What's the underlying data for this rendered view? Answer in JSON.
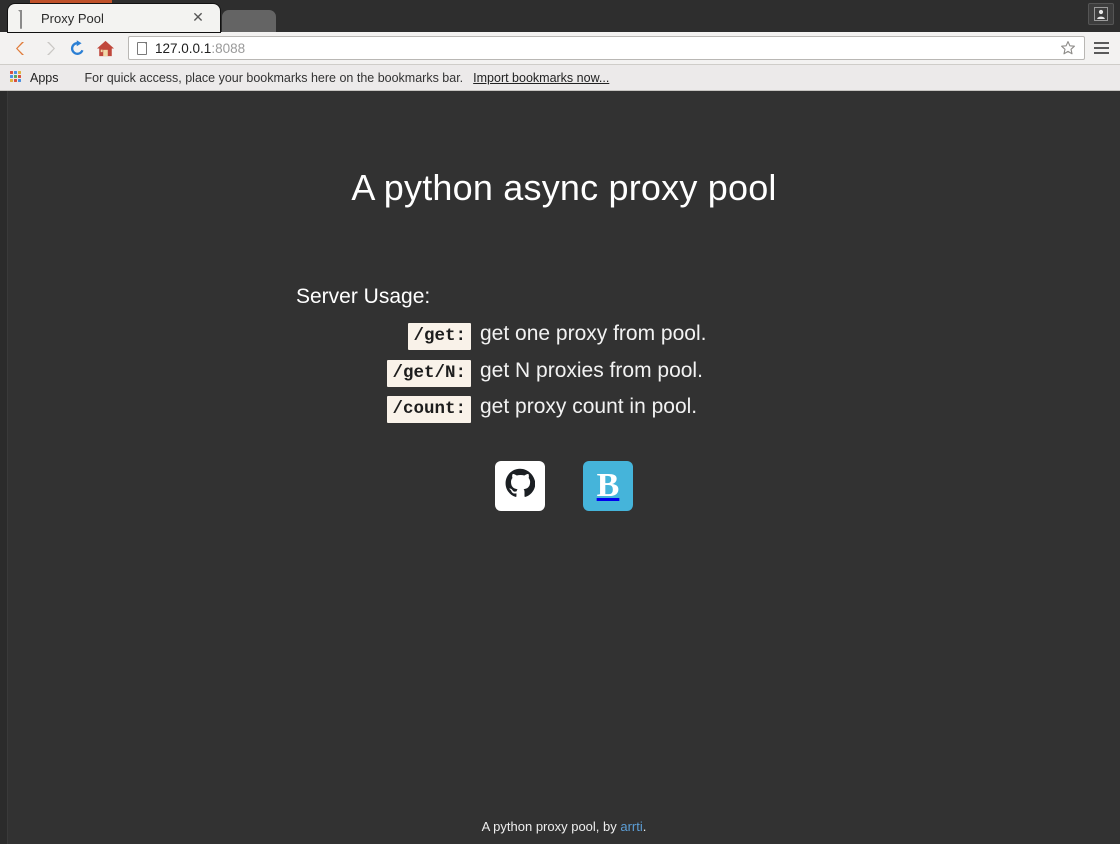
{
  "browser": {
    "tab": {
      "title": "Proxy Pool",
      "favicon_icon": "page-icon",
      "close_icon": "close-icon"
    },
    "nav": {
      "back_icon": "back-arrow-icon",
      "forward_icon": "forward-arrow-icon",
      "reload_icon": "reload-icon",
      "home_icon": "home-icon",
      "star_icon": "star-icon",
      "menu_icon": "hamburger-menu-icon",
      "avatar_icon": "user-avatar-icon"
    },
    "address_bar": {
      "host": "127.0.0.1",
      "port": ":8088",
      "full_url": "127.0.0.1:8088"
    },
    "bookmarks_bar": {
      "apps_label": "Apps",
      "hint": "For quick access, place your bookmarks here on the bookmarks bar.",
      "import_link": "Import bookmarks now..."
    }
  },
  "page": {
    "title": "A python async proxy pool",
    "usage_heading": "Server Usage:",
    "endpoints": [
      {
        "route": "/get:",
        "description": "get one proxy from pool."
      },
      {
        "route": "/get/N:",
        "description": "get N proxies from pool."
      },
      {
        "route": "/count:",
        "description": "get proxy count in pool."
      }
    ],
    "links": [
      {
        "name": "github",
        "icon": "github-icon",
        "label": ""
      },
      {
        "name": "blog",
        "icon": "blog-icon",
        "label": "B"
      }
    ],
    "footer": {
      "prefix": "A python proxy pool, by ",
      "author": "arrti",
      "suffix": "."
    },
    "colors": {
      "background": "#323232",
      "text": "#ffffff",
      "code_background": "#f9f2e9",
      "code_text": "#1d1d1d",
      "link": "#5c9ed6",
      "blog_badge": "#45b4da"
    }
  }
}
